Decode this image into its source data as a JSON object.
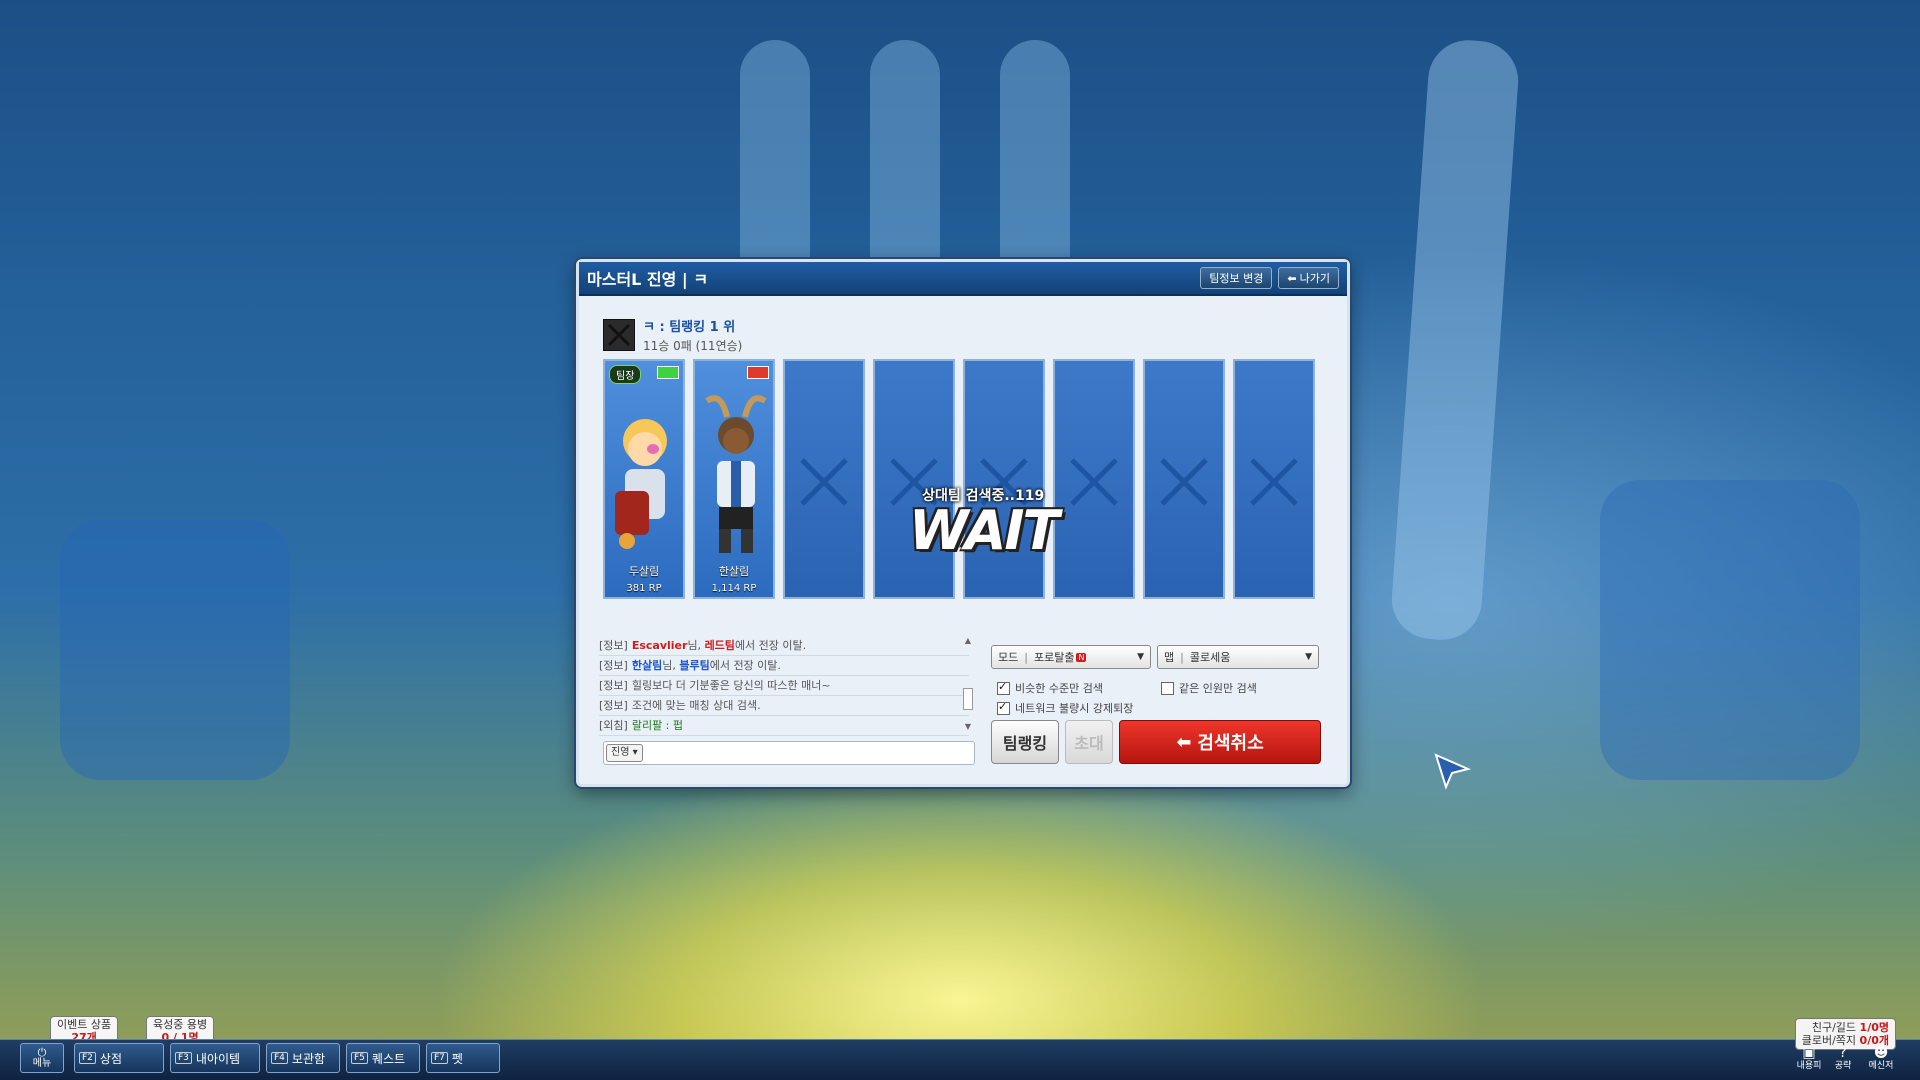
{
  "window": {
    "title": "마스터L 진영 | ㅋ",
    "change_info_label": "팀정보 변경",
    "exit_label": "나가기"
  },
  "team": {
    "name": "ㅋ : 팀랭킹 1 위",
    "record": "11승 0패 (11연승)"
  },
  "players": [
    {
      "name": "두살림",
      "rp": "381 RP",
      "badge": "팀장",
      "battery_color": "#3fd13f"
    },
    {
      "name": "한살림",
      "rp": "1,114 RP",
      "battery_color": "#e03a2a"
    }
  ],
  "empty_slot_count": 6,
  "wait": {
    "sub": "상대팀 검색중..119",
    "main": "WAIT"
  },
  "chat": {
    "lines": [
      {
        "prefix": "[정보]",
        "pre": "",
        "name1": "Escavlier",
        "mid": "님, ",
        "name2": "레드팀",
        "post": "에서 전장 이탈.",
        "color": "red"
      },
      {
        "prefix": "[정보]",
        "pre": "",
        "name1": "한살림",
        "mid": "님, ",
        "name2": "블루팀",
        "post": "에서 전장 이탈.",
        "color": "blue"
      },
      {
        "prefix": "[정보]",
        "pre": "",
        "name1": "",
        "mid": "",
        "name2": "",
        "post": "힐링보다 더 기분좋은 당신의 따스한 매너~",
        "color": "none"
      },
      {
        "prefix": "[정보]",
        "pre": "",
        "name1": "",
        "mid": "",
        "name2": "",
        "post": "조건에 맞는 매칭 상대 검색.",
        "color": "none"
      },
      {
        "prefix": "[외침]",
        "pre": "",
        "name1": "",
        "mid": "",
        "name2": "",
        "post": "랄리팔 : 펍",
        "color": "none"
      }
    ],
    "channel": "진영"
  },
  "options": {
    "mode_label": "모드",
    "mode_value": "포로탈출",
    "mode_badge": "N",
    "map_label": "맵",
    "map_value": "콜로세움",
    "similar_level_label": "비슷한 수준만 검색",
    "similar_level_checked": true,
    "same_count_label": "같은 인원만 검색",
    "same_count_checked": false,
    "network_kick_label": "네트워크 불량시 강제퇴장",
    "network_kick_checked": true
  },
  "buttons": {
    "team_ranking": "팀랭킹",
    "invite": "초대",
    "cancel_search": "검색취소"
  },
  "bottom_bar": {
    "event_notice_title": "이벤트 상품",
    "event_notice_count": "27개",
    "training_notice_title": "육성중 용병",
    "training_notice_count": "0 / 1명",
    "menu_label": "메뉴",
    "items": [
      {
        "key": "F2",
        "label": "상점"
      },
      {
        "key": "F3",
        "label": "내아이템"
      },
      {
        "key": "F4",
        "label": "보관함"
      },
      {
        "key": "F5",
        "label": "퀘스트"
      },
      {
        "key": "F7",
        "label": "펫"
      }
    ],
    "friends_label": "친구/길드",
    "friends_value": "1/0명",
    "club_label": "클로버/쪽지",
    "club_value": "0/0개",
    "tray": [
      "내용피",
      "공략",
      "메신저"
    ]
  }
}
